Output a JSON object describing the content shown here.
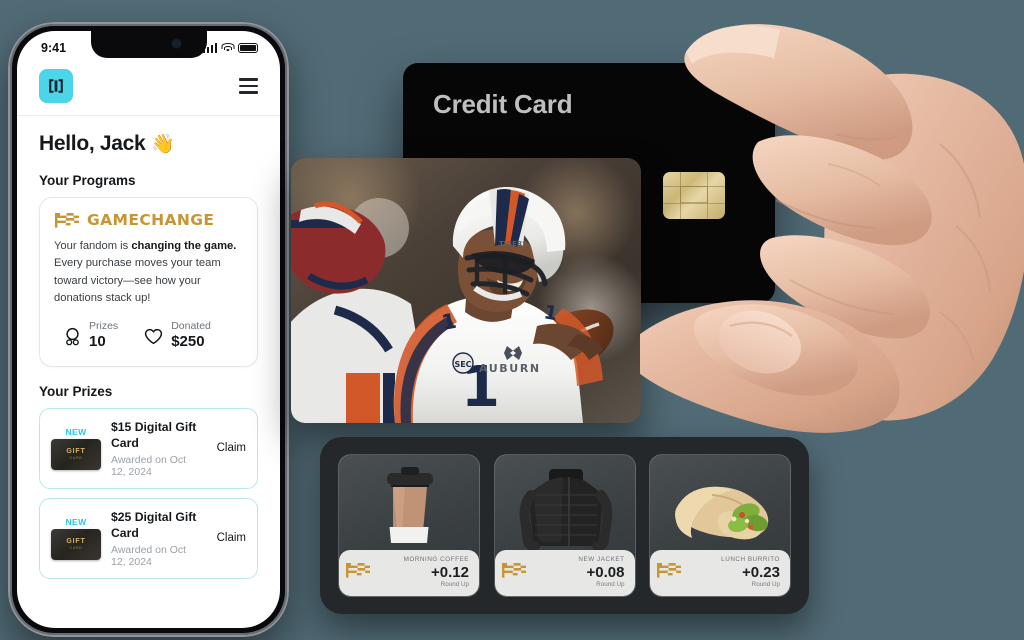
{
  "theme": {
    "background": "#516b76",
    "brand_cyan": "#4CD4E8",
    "gold": "#C79532",
    "dark": "#15191c"
  },
  "phone": {
    "status_bar": {
      "time": "9:41",
      "signal_icon": "cellular-signal-icon",
      "wifi_icon": "wifi-icon",
      "battery_icon": "battery-icon"
    },
    "header": {
      "logo_icon": "app-logo-icon",
      "menu_icon": "hamburger-menu-icon"
    },
    "greeting": "Hello, Jack",
    "greeting_emoji": "👋",
    "programs_section_title": "Your Programs",
    "program_card": {
      "logo_icon": "gamechange-flag-icon",
      "wordmark": "GAMECHANGE",
      "copy_lead": "Your fandom is ",
      "copy_bold": "changing the game.",
      "copy_rest": " Every purchase moves your team toward victory—see how your donations stack up!",
      "stats": [
        {
          "icon": "award-ribbon-icon",
          "label": "Prizes",
          "value": "10"
        },
        {
          "icon": "heart-icon",
          "label": "Donated",
          "value": "$250"
        }
      ]
    },
    "prizes_section_title": "Your Prizes",
    "prizes": [
      {
        "badge": "NEW",
        "thumb_icon": "gift-card-icon",
        "thumb_line1": "GIFT",
        "thumb_line2": "CARD",
        "name": "$15 Digital Gift Card",
        "date": "Awarded on Oct 12, 2024",
        "action": "Claim"
      },
      {
        "badge": "NEW",
        "thumb_icon": "gift-card-icon",
        "thumb_line1": "GIFT",
        "thumb_line2": "CARD",
        "name": "$25 Digital Gift Card",
        "date": "Awarded on Oct 12, 2024",
        "action": "Claim"
      }
    ]
  },
  "credit_card": {
    "title": "Credit Card",
    "chip_icon": "emv-chip-icon"
  },
  "hand": {
    "icon": "hand-holding-card-photo"
  },
  "photo_card": {
    "icon": "auburn-football-player-photo",
    "jersey_number": "1",
    "team_text": "AUBURN",
    "conference_text": "SEC"
  },
  "roundup_tray": {
    "cards": [
      {
        "product_icon": "coffee-cup-icon",
        "label": "MORNING COFFEE",
        "amount": "+0.12",
        "sublabel": "Round Up",
        "mark_icon": "gamechange-flag-icon"
      },
      {
        "product_icon": "puffer-jacket-icon",
        "label": "NEW JACKET",
        "amount": "+0.08",
        "sublabel": "Round Up",
        "mark_icon": "gamechange-flag-icon"
      },
      {
        "product_icon": "burrito-icon",
        "label": "LUNCH BURRITO",
        "amount": "+0.23",
        "sublabel": "Round Up",
        "mark_icon": "gamechange-flag-icon"
      }
    ]
  }
}
